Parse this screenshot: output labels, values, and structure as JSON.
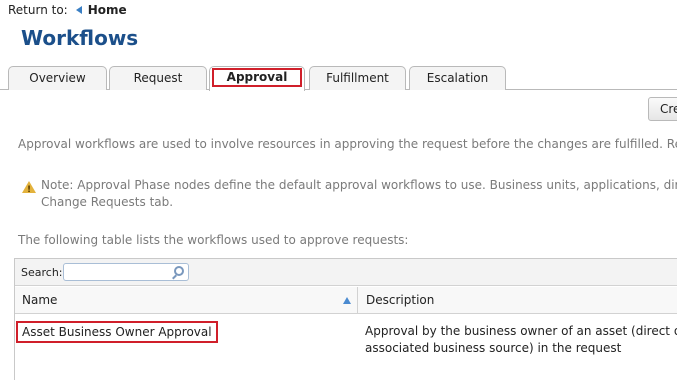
{
  "nav": {
    "return_label": "Return to:",
    "home_label": "Home"
  },
  "page": {
    "title": "Workflows"
  },
  "tabs": [
    {
      "label": "Overview"
    },
    {
      "label": "Request"
    },
    {
      "label": "Approval",
      "active": true
    },
    {
      "label": "Fulfillment"
    },
    {
      "label": "Escalation"
    }
  ],
  "toolbar": {
    "create_label": "Cre"
  },
  "content": {
    "description": "Approval workflows are used to involve resources in approving the request before the changes are fulfilled. Req",
    "note_line1": "Note: Approval Phase nodes define the default approval workflows to use. Business units, applications, direc",
    "note_line2": "Change Requests tab.",
    "table_intro": "The following table lists the workflows used to approve requests:"
  },
  "table": {
    "search_label": "Search:",
    "search_value": "",
    "columns": [
      "Name",
      "Description"
    ],
    "rows": [
      {
        "name": "Asset Business Owner Approval",
        "desc_line1": "Approval by the business owner of an asset (direct or",
        "desc_line2": "associated business source) in the request"
      }
    ]
  },
  "colors": {
    "title": "#1b4f8a",
    "highlight": "#d01f2a",
    "accent": "#3a7fc4"
  }
}
